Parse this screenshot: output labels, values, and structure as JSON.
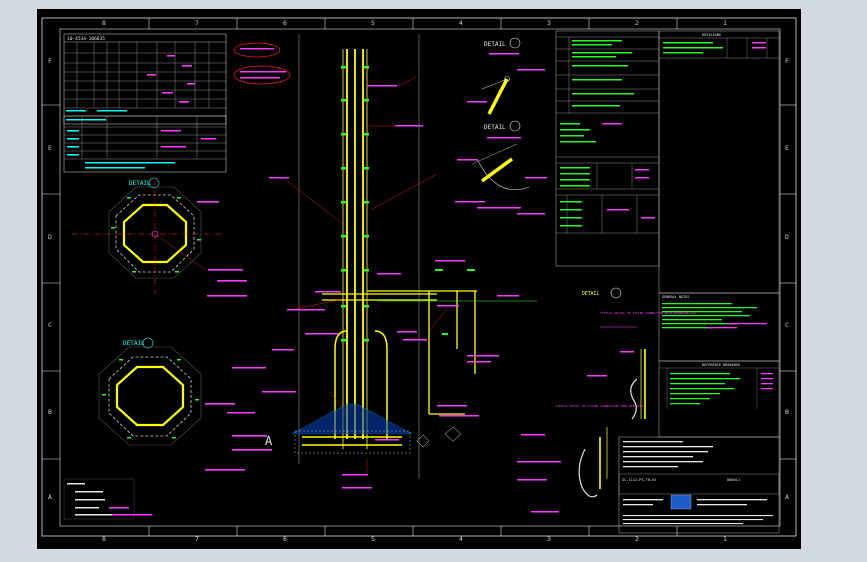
{
  "border": {
    "columns": [
      "8",
      "7",
      "6",
      "5",
      "4",
      "3",
      "2",
      "1"
    ],
    "rows": [
      "F",
      "E",
      "D",
      "C",
      "B",
      "A"
    ]
  },
  "labels": {
    "pile_table": "10-4534-106635",
    "detail_a": "DETAIL",
    "detail_b": "DETAIL",
    "detail_c": "DETAIL",
    "detail_d": "DETAIL",
    "detail_e": "DETAIL",
    "main_section": "A",
    "typ_detail_1": "TYPICAL DETAIL OF ATTIRE CONNECTION WITH BLEEDING LUG",
    "typ_detail_2": "TYPICAL DETAIL OF ATTIRE CONNECTION FROM BLEEDING",
    "revision_title": "REVISIONS",
    "general_notes_title": "GENERAL NOTES",
    "reference_drawings": "REFERENCE DRAWINGS",
    "drawing_number": "SC-1112-PS-TR-01",
    "sheet_no": "000011"
  },
  "colors": {
    "structure": "#ffff00",
    "annotation": "#ff38ff",
    "dimension": "#22ff22",
    "border": "#e0e0e0",
    "leader": "#ff2020",
    "table": "#00ffff"
  }
}
